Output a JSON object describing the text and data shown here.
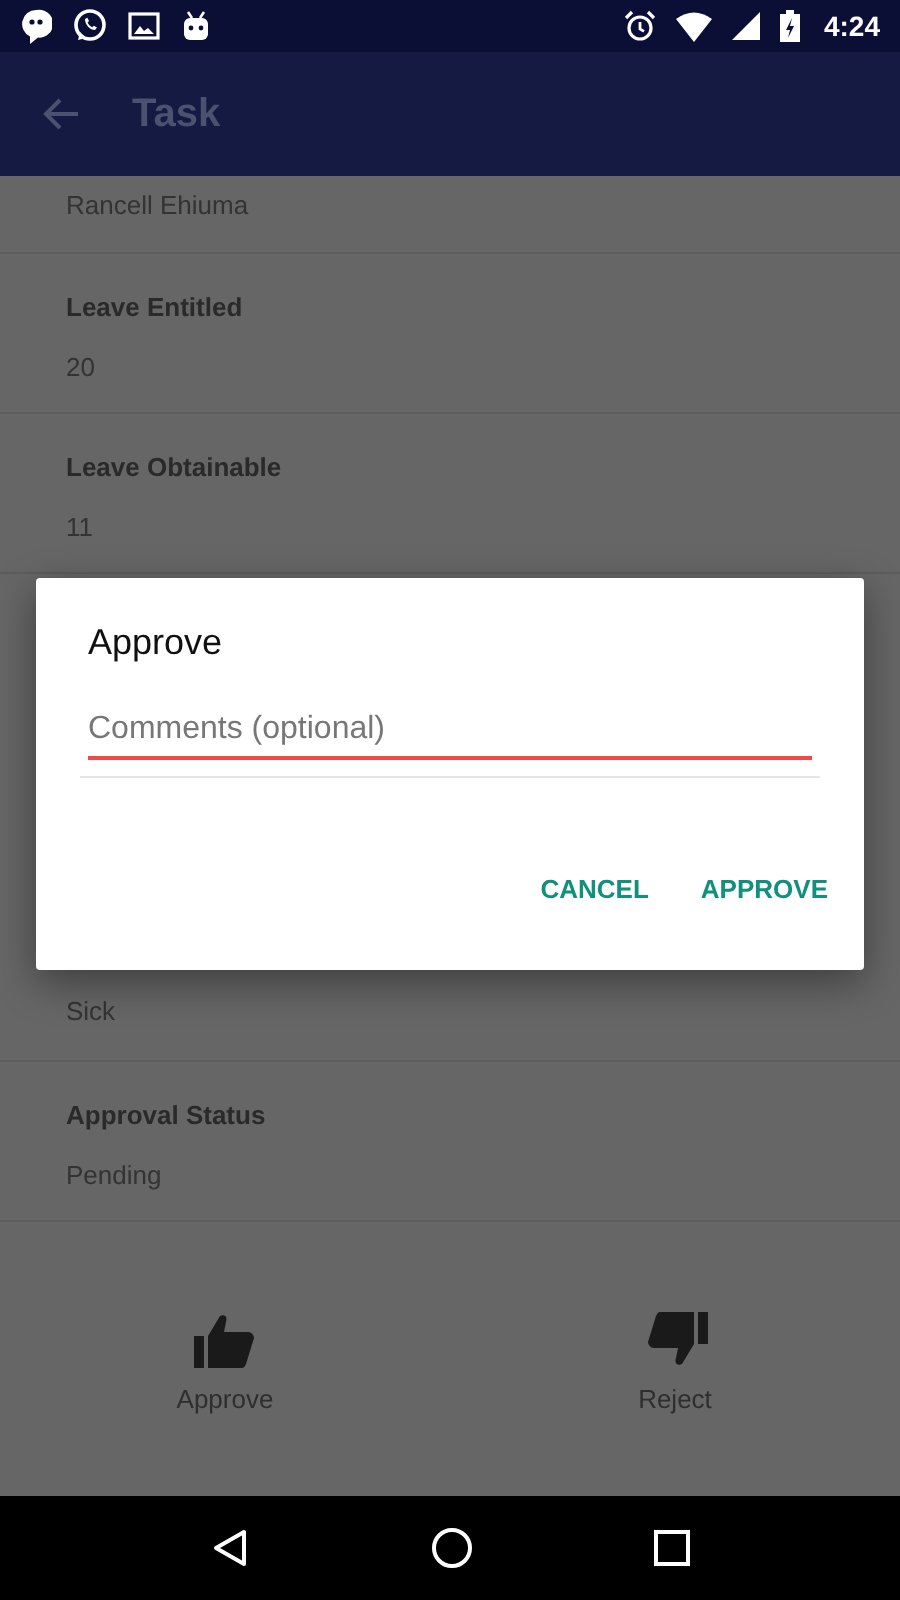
{
  "status_bar": {
    "time": "4:24"
  },
  "app_bar": {
    "title": "Task"
  },
  "fields_above": [
    {
      "value": "Rancell Ehiuma"
    },
    {
      "label": "Leave Entitled",
      "value": "20"
    },
    {
      "label": "Leave Obtainable",
      "value": "11"
    }
  ],
  "fields_below": [
    {
      "value": "Sick"
    },
    {
      "label": "Approval Status",
      "value": "Pending"
    }
  ],
  "actions": [
    {
      "kind": "approve",
      "label": "Approve"
    },
    {
      "kind": "reject",
      "label": "Reject"
    }
  ],
  "dialog": {
    "title": "Approve",
    "comment_field": {
      "placeholder": "Comments (optional)"
    },
    "buttons": [
      "CANCEL",
      "APPROVE"
    ]
  }
}
